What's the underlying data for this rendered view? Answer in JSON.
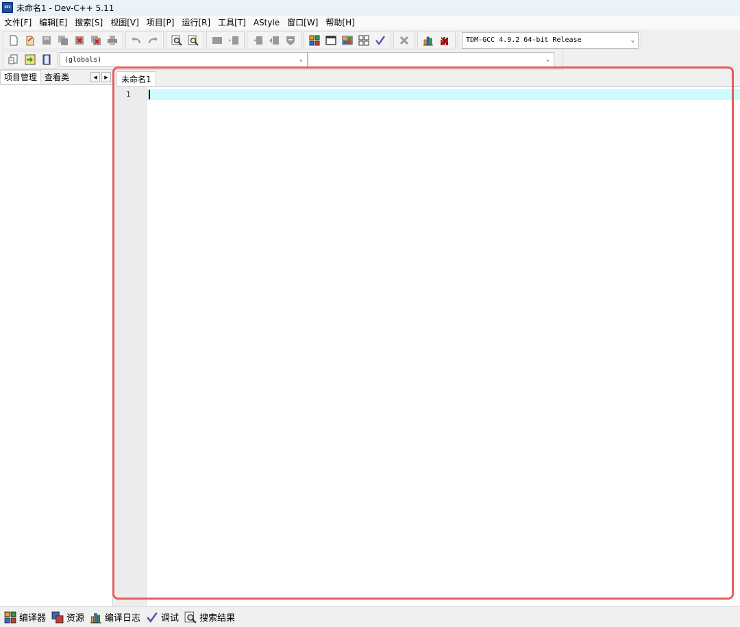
{
  "window": {
    "title": "未命名1 - Dev-C++ 5.11",
    "logo_text": "DEV"
  },
  "menu": [
    "文件[F]",
    "编辑[E]",
    "搜索[S]",
    "视图[V]",
    "项目[P]",
    "运行[R]",
    "工具[T]",
    "AStyle",
    "窗口[W]",
    "帮助[H]"
  ],
  "toolbar": {
    "compiler": "TDM-GCC 4.9.2 64-bit Release"
  },
  "scope": {
    "class_value": "(globals)",
    "member_value": ""
  },
  "left_panel": {
    "tab_project": "项目管理",
    "tab_classes": "查看类"
  },
  "editor": {
    "tab_title": "未命名1",
    "line_number": "1"
  },
  "bottom_tabs": [
    "编译器",
    "资源",
    "编译日志",
    "调试",
    "搜索结果"
  ],
  "colors": {
    "highlight_border": "#e65d5d",
    "current_line": "#ccfcfd"
  }
}
